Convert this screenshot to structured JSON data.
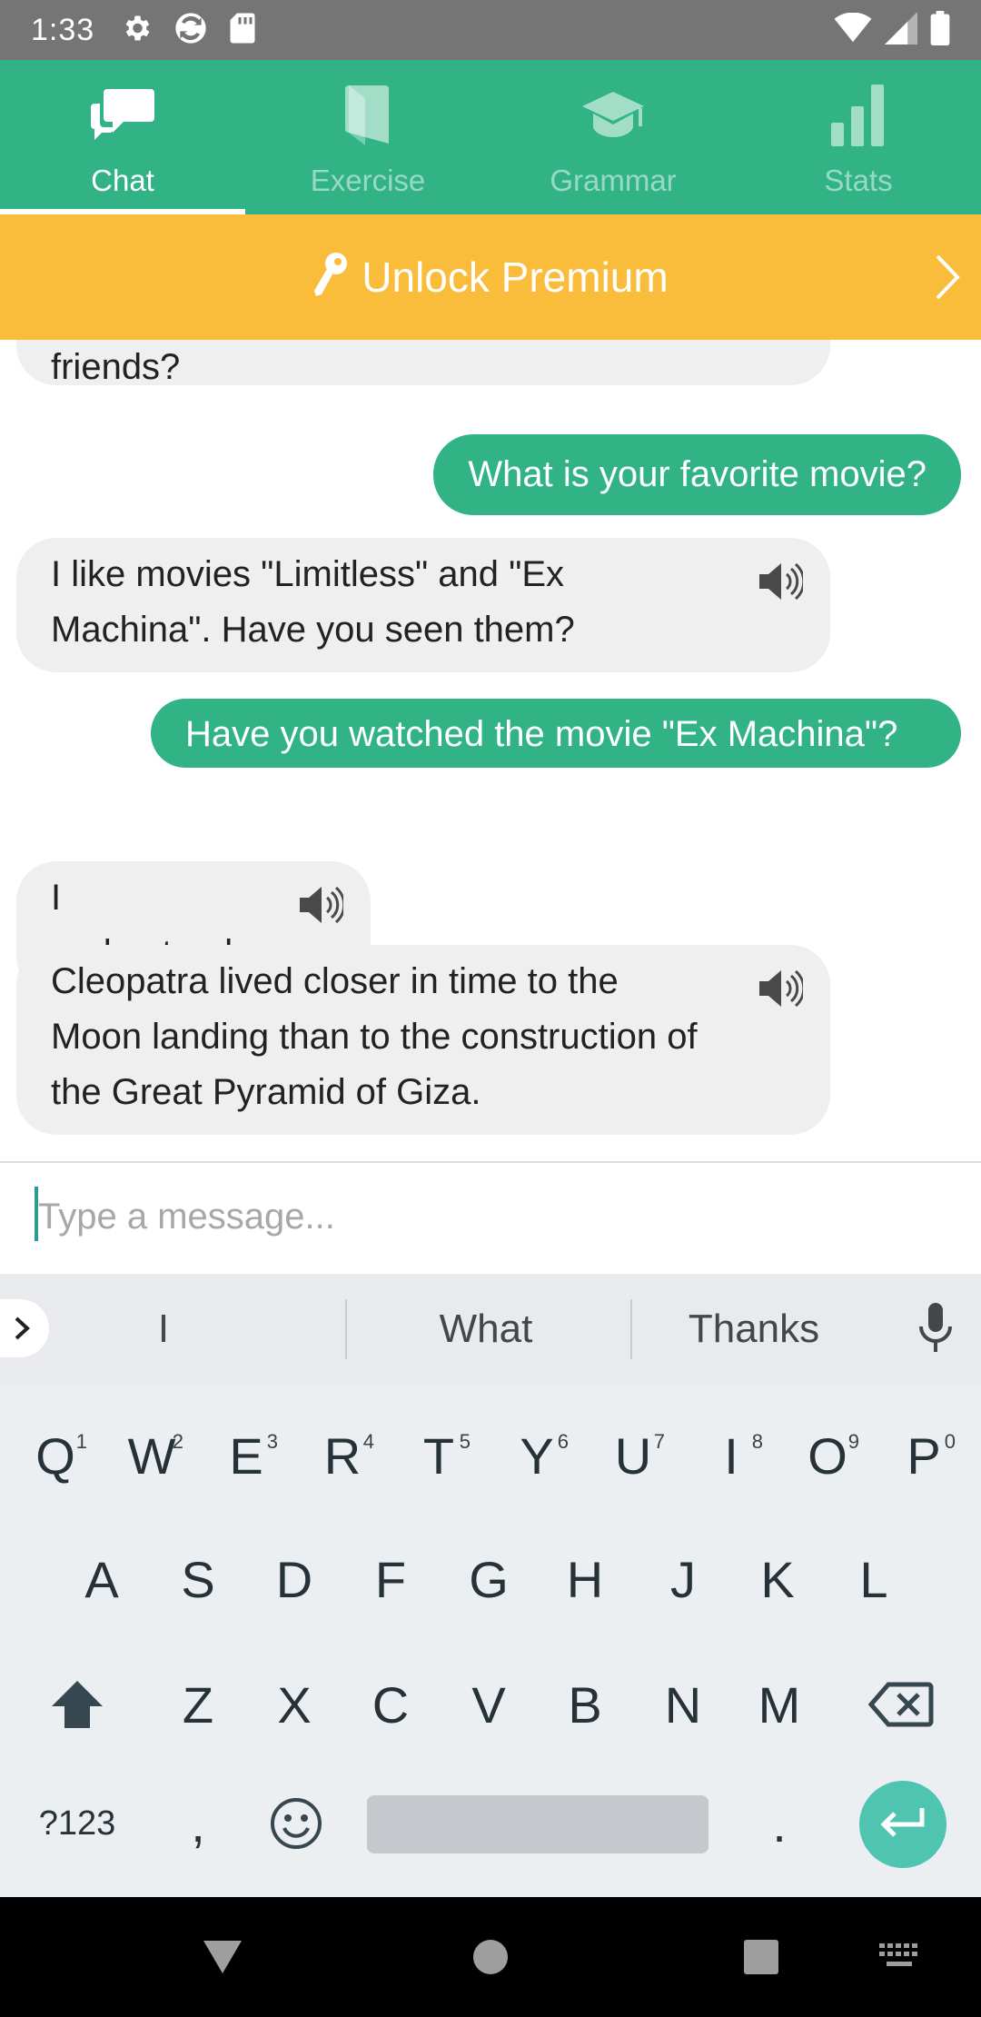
{
  "status_bar": {
    "time": "1:33"
  },
  "tabs": [
    {
      "label": "Chat",
      "icon": "chat-icon",
      "active": true
    },
    {
      "label": "Exercise",
      "icon": "book-icon",
      "active": false
    },
    {
      "label": "Grammar",
      "icon": "graduation-cap-icon",
      "active": false
    },
    {
      "label": "Stats",
      "icon": "bar-chart-icon",
      "active": false
    }
  ],
  "premium": {
    "label": "Unlock Premium",
    "icon": "key-icon"
  },
  "chat": {
    "messages": [
      {
        "from": "bot",
        "text": "friends?"
      },
      {
        "from": "user",
        "text": "What is your favorite movie?"
      },
      {
        "from": "bot",
        "text": "I like movies \"Limitless\" and \"Ex Machina\". Have you seen them?"
      },
      {
        "from": "user",
        "text": "Have you watched the movie \"Ex Machina\"?"
      },
      {
        "from": "bot",
        "text": "I understand"
      },
      {
        "from": "bot",
        "text": "Cleopatra lived closer in time to the Moon landing than to the construction of the Great Pyramid of Giza."
      }
    ]
  },
  "input": {
    "placeholder": "Type a message...",
    "value": ""
  },
  "keyboard": {
    "suggestions": [
      "I",
      "What",
      "Thanks"
    ],
    "row1": [
      {
        "key": "Q",
        "num": "1"
      },
      {
        "key": "W",
        "num": "2"
      },
      {
        "key": "E",
        "num": "3"
      },
      {
        "key": "R",
        "num": "4"
      },
      {
        "key": "T",
        "num": "5"
      },
      {
        "key": "Y",
        "num": "6"
      },
      {
        "key": "U",
        "num": "7"
      },
      {
        "key": "I",
        "num": "8"
      },
      {
        "key": "O",
        "num": "9"
      },
      {
        "key": "P",
        "num": "0"
      }
    ],
    "row2": [
      "A",
      "S",
      "D",
      "F",
      "G",
      "H",
      "J",
      "K",
      "L"
    ],
    "row3": [
      "Z",
      "X",
      "C",
      "V",
      "B",
      "N",
      "M"
    ],
    "symbols_label": "?123",
    "comma": ",",
    "period": "."
  },
  "colors": {
    "brand_green": "#31b386",
    "premium_yellow": "#f9bd3b",
    "bot_bubble": "#efefef",
    "enter_teal": "#4ec4b1"
  }
}
